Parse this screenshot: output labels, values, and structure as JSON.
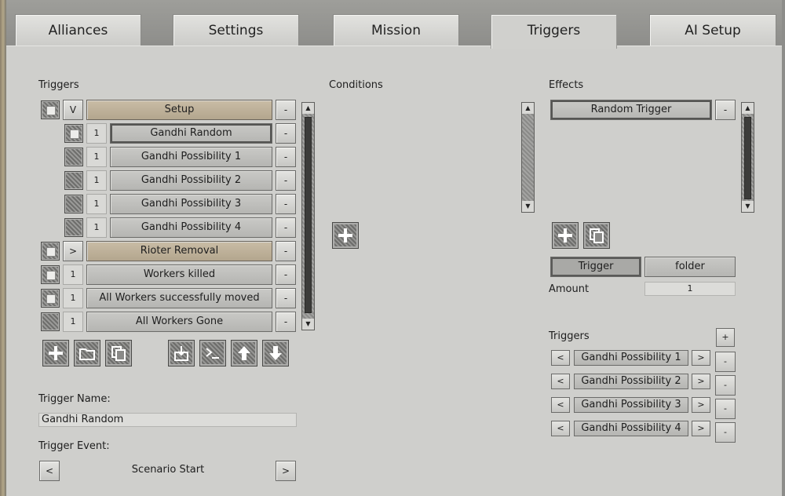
{
  "tabs": [
    {
      "label": "Alliances"
    },
    {
      "label": "Settings"
    },
    {
      "label": "Mission"
    },
    {
      "label": "Triggers"
    },
    {
      "label": "AI Setup"
    }
  ],
  "active_tab": "Triggers",
  "triggers_panel": {
    "title": "Triggers",
    "remove_label": "-",
    "items": [
      {
        "label": "Setup",
        "prefix": "V",
        "kind": "folder",
        "checked": true,
        "indent": 0
      },
      {
        "label": "Gandhi Random",
        "prefix": "1",
        "kind": "trigger",
        "checked": true,
        "indent": 1,
        "selected": true
      },
      {
        "label": "Gandhi Possibility 1",
        "prefix": "1",
        "kind": "trigger",
        "checked": false,
        "indent": 1
      },
      {
        "label": "Gandhi Possibility 2",
        "prefix": "1",
        "kind": "trigger",
        "checked": false,
        "indent": 1
      },
      {
        "label": "Gandhi Possibility 3",
        "prefix": "1",
        "kind": "trigger",
        "checked": false,
        "indent": 1
      },
      {
        "label": "Gandhi Possibility 4",
        "prefix": "1",
        "kind": "trigger",
        "checked": false,
        "indent": 1
      },
      {
        "label": "Rioter Removal",
        "prefix": ">",
        "kind": "folder",
        "checked": true,
        "indent": 0
      },
      {
        "label": "Workers killed",
        "prefix": "1",
        "kind": "trigger",
        "checked": true,
        "indent": 0
      },
      {
        "label": "All Workers successfully moved",
        "prefix": "1",
        "kind": "trigger",
        "checked": true,
        "indent": 0
      },
      {
        "label": "All Workers Gone",
        "prefix": "1",
        "kind": "trigger",
        "checked": false,
        "indent": 0
      }
    ],
    "toolbar_icons": [
      "add-icon",
      "folder-icon",
      "copy-icon",
      "import-icon",
      "console-icon",
      "move-up-icon",
      "move-down-icon"
    ]
  },
  "trigger_name": {
    "label": "Trigger Name:",
    "value": "Gandhi Random"
  },
  "trigger_event": {
    "label": "Trigger Event:",
    "value": "Scenario Start",
    "prev": "<",
    "next": ">"
  },
  "conditions": {
    "title": "Conditions"
  },
  "effects": {
    "title": "Effects",
    "items": [
      {
        "label": "Random Trigger"
      }
    ],
    "remove_label": "-",
    "mode_buttons": {
      "trigger": "Trigger",
      "folder": "folder"
    },
    "amount_label": "Amount",
    "amount_value": "1",
    "triggers_label": "Triggers",
    "add_label": "+",
    "targets": [
      {
        "label": "Gandhi Possibility 1"
      },
      {
        "label": "Gandhi Possibility 2"
      },
      {
        "label": "Gandhi Possibility 3"
      },
      {
        "label": "Gandhi Possibility 4"
      }
    ],
    "prev": "<",
    "next": ">"
  }
}
